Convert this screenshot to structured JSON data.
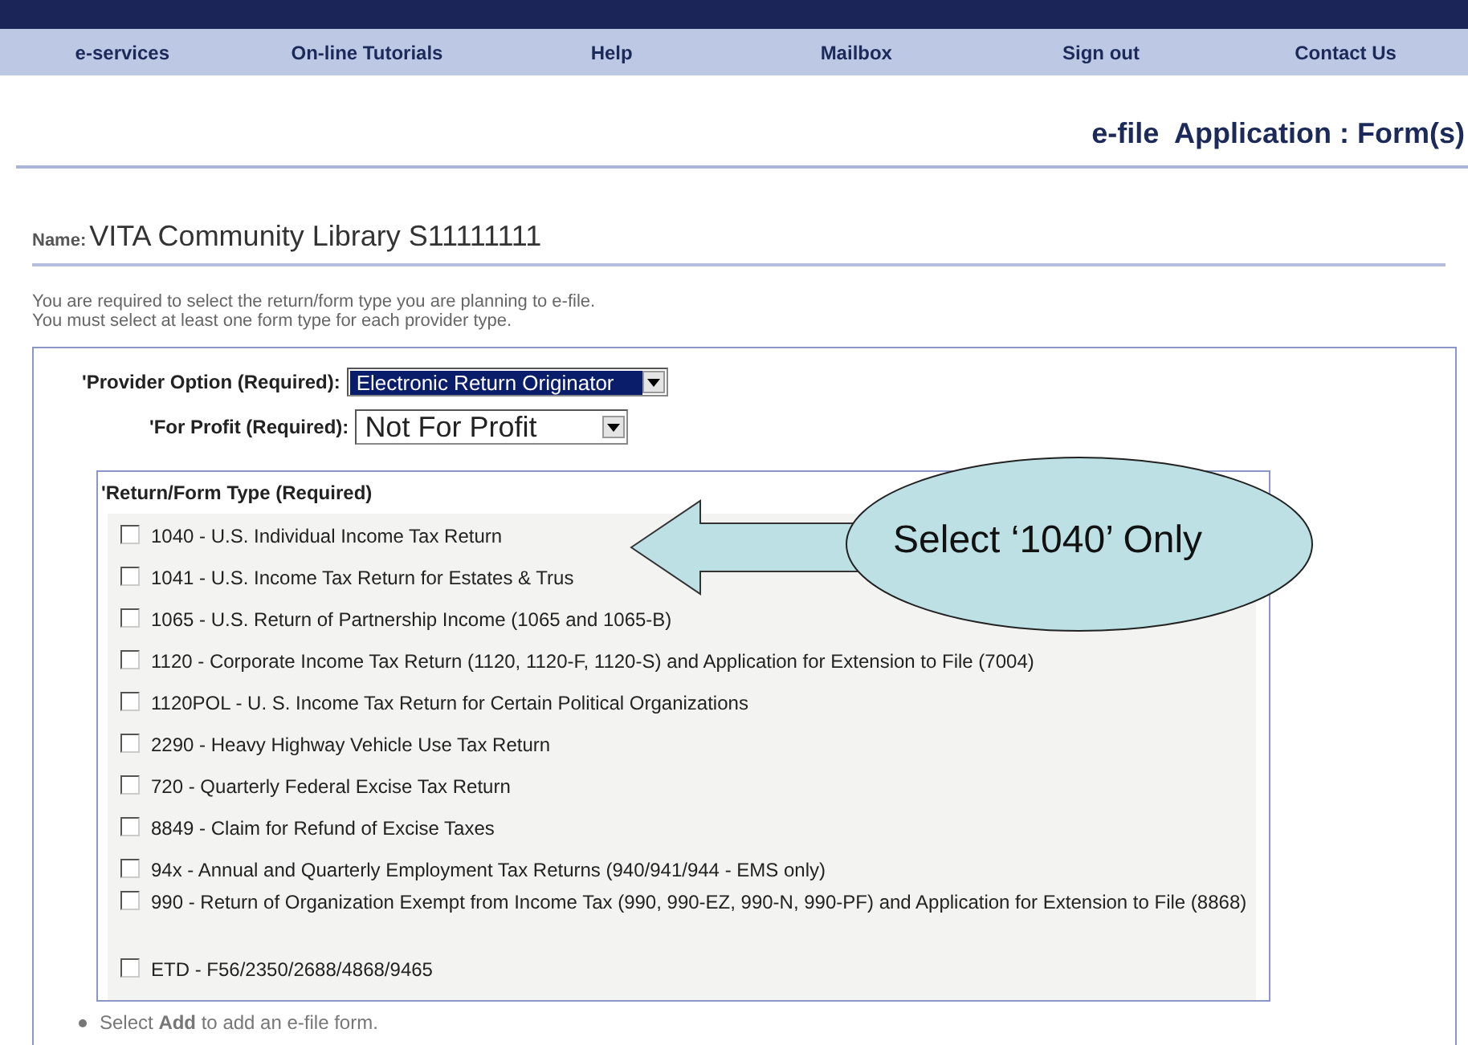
{
  "nav": [
    "e-services",
    "On-line Tutorials",
    "Help",
    "Mailbox",
    "Sign out",
    "Contact Us"
  ],
  "page_title": "e-file  Application : Form(s)",
  "name": {
    "label": "Name:",
    "value": "VITA Community Library S11111111"
  },
  "instructions": [
    "You are required to select the return/form type you are planning to e-file.",
    "You must select at least one form type for each provider type."
  ],
  "provider_option": {
    "label": "'Provider Option (Required):",
    "value": "Electronic Return Originator",
    "highlighted": true
  },
  "for_profit": {
    "label": "'For Profit (Required):",
    "value": "Not For Profit",
    "highlighted": false
  },
  "form_types": {
    "title": "'Return/Form Type (Required)",
    "items": [
      {
        "label": "1040 - U.S. Individual Income Tax Return",
        "checked": false
      },
      {
        "label": "1041 - U.S. Income Tax Return for Estates & Trus",
        "checked": false
      },
      {
        "label": "1065 - U.S. Return of Partnership Income (1065 and 1065-B)",
        "checked": false
      },
      {
        "label": "1120 - Corporate Income Tax Return (1120, 1120-F, 1120-S) and Application for Extension to File (7004)",
        "checked": false
      },
      {
        "label": "1120POL - U. S. Income Tax Return for Certain Political Organizations",
        "checked": false
      },
      {
        "label": "2290 - Heavy Highway Vehicle Use Tax Return",
        "checked": false
      },
      {
        "label": "720 - Quarterly Federal Excise Tax Return",
        "checked": false
      },
      {
        "label": "8849 - Claim for Refund of Excise Taxes",
        "checked": false
      },
      {
        "label": "94x - Annual and Quarterly Employment Tax Returns (940/941/944 - EMS only)",
        "checked": false
      },
      {
        "label": "990 - Return of Organization Exempt from Income Tax (990, 990-EZ, 990-N, 990-PF) and Application for Extension to File (8868)",
        "checked": false
      },
      {
        "label": "ETD - F56/2350/2688/4868/9465",
        "checked": false
      }
    ]
  },
  "callout": {
    "text": "Select ‘1040’ Only"
  },
  "notes": [
    "Select **Add** to add an e-file form."
  ]
}
